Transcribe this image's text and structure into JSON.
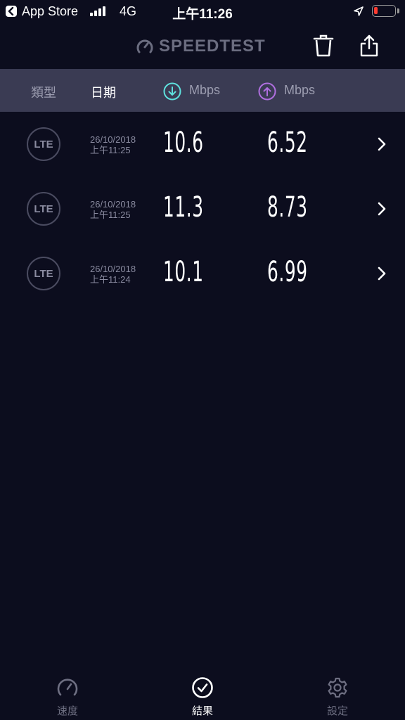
{
  "status_bar": {
    "back_app": "App Store",
    "network": "4G",
    "time": "上午11:26",
    "battery_color": "#ff3b30"
  },
  "header": {
    "logo_text": "SPEEDTEST",
    "icons": [
      "speedometer-icon",
      "trash-icon",
      "share-icon"
    ]
  },
  "columns": {
    "type": "類型",
    "date": "日期",
    "download_unit": "Mbps",
    "upload_unit": "Mbps",
    "download_color": "#5ee0dd",
    "upload_color": "#b06fe0"
  },
  "results": [
    {
      "type": "LTE",
      "date": "26/10/2018",
      "time": "上午11:25",
      "download": "10.6",
      "upload": "6.52"
    },
    {
      "type": "LTE",
      "date": "26/10/2018",
      "time": "上午11:25",
      "download": "11.3",
      "upload": "8.73"
    },
    {
      "type": "LTE",
      "date": "26/10/2018",
      "time": "上午11:24",
      "download": "10.1",
      "upload": "6.99"
    }
  ],
  "tabbar": {
    "speed": "速度",
    "results": "結果",
    "settings": "設定",
    "active": "results"
  }
}
